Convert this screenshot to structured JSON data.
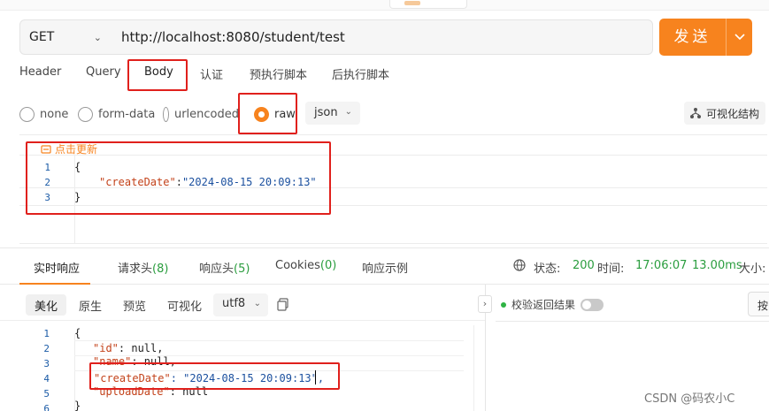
{
  "request": {
    "method": "GET",
    "url": "http://localhost:8080/student/test",
    "send_label": "发送"
  },
  "request_tabs": [
    "Header",
    "Query",
    "Body",
    "认证",
    "预执行脚本",
    "后执行脚本"
  ],
  "active_request_tab": "Body",
  "body_types": [
    "none",
    "form-data",
    "urlencoded",
    "raw"
  ],
  "selected_body_type": "raw",
  "body_format": "json",
  "visualize_label": "可视化结构",
  "update_link": "点击更新",
  "request_body_lines": [
    {
      "n": "1",
      "text": "{"
    },
    {
      "n": "2",
      "key": "\"createDate\"",
      "sep": ":",
      "val": "\"2024-08-15 20:09:13\""
    },
    {
      "n": "3",
      "text": "}"
    }
  ],
  "response_tabs": {
    "realtime": "实时响应",
    "req_headers": "请求头",
    "req_headers_count": "(8)",
    "resp_headers": "响应头",
    "resp_headers_count": "(5)",
    "cookies": "Cookies",
    "cookies_count": "(0)",
    "example": "响应示例"
  },
  "status": {
    "status_label": "状态:",
    "status_code": "200",
    "time_label": "时间:",
    "time_value": "17:06:07",
    "duration": "13.00ms",
    "size_label": "大小:"
  },
  "format_buttons": [
    "美化",
    "原生",
    "预览",
    "可视化"
  ],
  "active_format": "美化",
  "encoding": "utf8",
  "verify_label": "校验返回结果",
  "cut_button": "按",
  "response_lines": [
    {
      "n": "1",
      "text": "{"
    },
    {
      "n": "2",
      "key": "\"id\"",
      "val": ": null,"
    },
    {
      "n": "3",
      "key": "\"name\"",
      "val": ": null,"
    },
    {
      "n": "4",
      "key": "\"createDate\"",
      "val": ": \"2024-08-15 20:09:13\","
    },
    {
      "n": "5",
      "key": "\"uploadDate\"",
      "val": ": null"
    },
    {
      "n": "6",
      "text": "}"
    }
  ],
  "watermark": "CSDN @码农小C",
  "colors": {
    "accent": "#f7831e",
    "annotation": "#e0201c",
    "success": "#2a9d3e"
  }
}
